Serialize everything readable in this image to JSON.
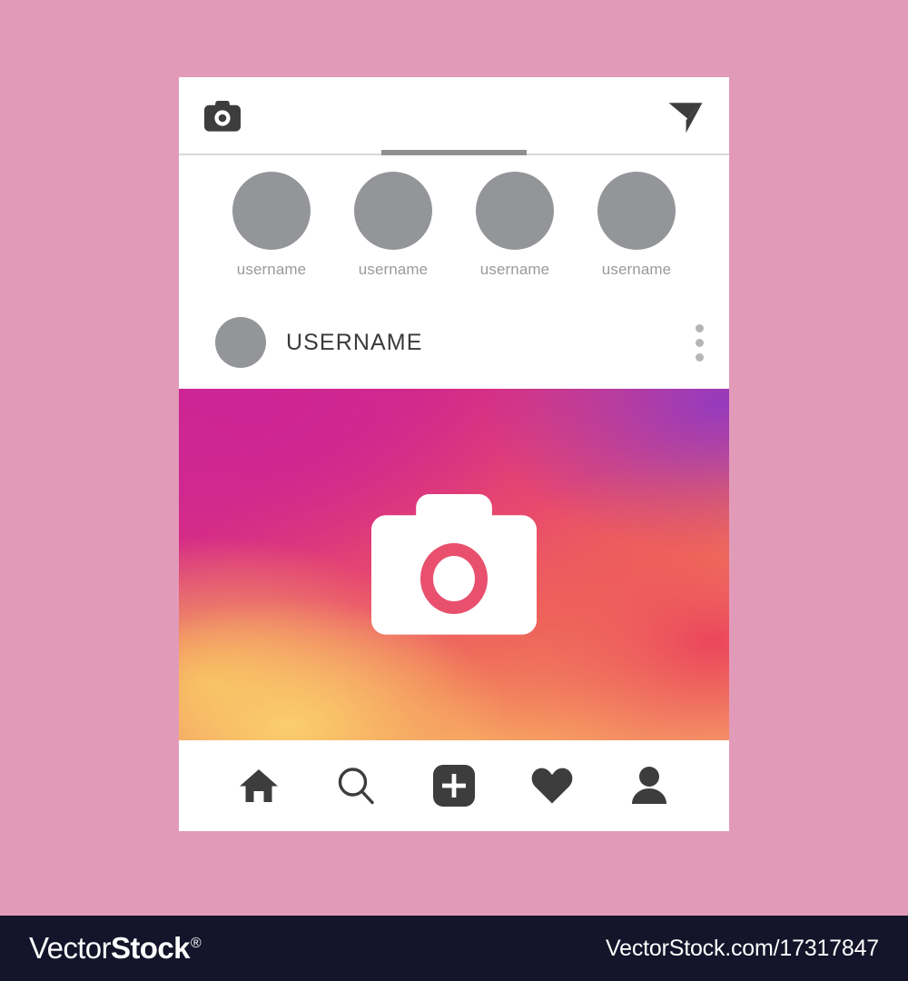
{
  "app": {
    "name": "Instagram-style social app mockup",
    "card_background": "#ffffff",
    "accent_pink": "#e8506e",
    "muted_gray": "#939599"
  },
  "topbar": {
    "camera_icon": "camera-icon",
    "send_icon": "send-paper-plane-icon",
    "tab_indicator_color": "#8f8f93",
    "divider_color": "#d9d9d9"
  },
  "stories": [
    {
      "label": "username",
      "avatar": "avatar-placeholder"
    },
    {
      "label": "username",
      "avatar": "avatar-placeholder"
    },
    {
      "label": "username",
      "avatar": "avatar-placeholder"
    },
    {
      "label": "username",
      "avatar": "avatar-placeholder"
    }
  ],
  "post": {
    "avatar": "avatar-placeholder",
    "username": "USERNAME",
    "menu_icon": "more-options-vertical-icon",
    "photo": {
      "placeholder_icon": "camera-icon",
      "gradient_from": "#cc2a94",
      "gradient_to": "#fbcf6e",
      "lens_color": "#e8506e"
    }
  },
  "bottom_nav": [
    {
      "name": "home",
      "icon": "home-icon",
      "active": true
    },
    {
      "name": "search",
      "icon": "search-icon",
      "active": false
    },
    {
      "name": "add",
      "icon": "plus-square-icon",
      "active": false
    },
    {
      "name": "activity",
      "icon": "heart-icon",
      "active": false
    },
    {
      "name": "profile",
      "icon": "person-icon",
      "active": false
    }
  ],
  "watermark": {
    "logo_thin": "Vector",
    "logo_bold": "Stock",
    "logo_registered": "®",
    "url": "VectorStock.com/17317847",
    "bar_color": "#14142a"
  },
  "background": {
    "top_left": "#d884c8",
    "top_right": "#b57ad8",
    "bottom_left": "#fad89f",
    "bottom_right": "#f0899a"
  }
}
